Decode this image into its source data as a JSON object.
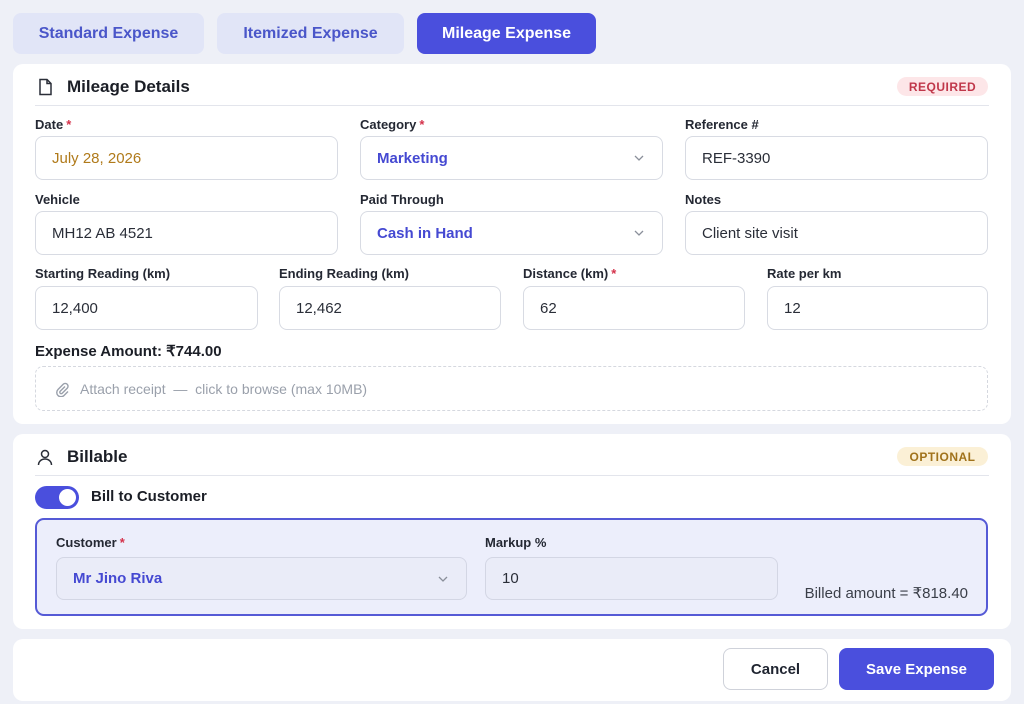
{
  "tabs": [
    {
      "label": "Standard Expense",
      "active": false
    },
    {
      "label": "Itemized Expense",
      "active": false
    },
    {
      "label": "Mileage Expense",
      "active": true
    }
  ],
  "mileage": {
    "title": "Mileage Details",
    "badge": "REQUIRED",
    "date": {
      "label": "Date",
      "value": "July 28, 2026",
      "required": true
    },
    "category": {
      "label": "Category",
      "value": "Marketing",
      "required": true
    },
    "reference": {
      "label": "Reference #",
      "value": "REF-3390"
    },
    "vehicle": {
      "label": "Vehicle",
      "value": "MH12 AB 4521"
    },
    "paid_through": {
      "label": "Paid Through",
      "value": "Cash in Hand"
    },
    "notes": {
      "label": "Notes",
      "value": "Client site visit"
    },
    "start_reading": {
      "label": "Starting Reading (km)",
      "value": "12,400"
    },
    "end_reading": {
      "label": "Ending Reading (km)",
      "value": "12,462"
    },
    "distance": {
      "label": "Distance (km)",
      "value": "62",
      "required": true
    },
    "rate": {
      "label": "Rate per km",
      "value": "12"
    },
    "expense_amount": "Expense Amount: ₹744.00",
    "attach": "Attach receipt  —  click to browse (max 10MB)"
  },
  "billable": {
    "title": "Billable",
    "badge": "OPTIONAL",
    "toggle_label": "Bill to Customer",
    "toggle_on": true,
    "customer": {
      "label": "Customer",
      "value": "Mr Jino Riva",
      "required": true
    },
    "markup": {
      "label": "Markup %",
      "value": "10"
    },
    "billed_amount": "Billed amount = ₹818.40"
  },
  "actions": {
    "cancel": "Cancel",
    "save": "Save Expense"
  },
  "colors": {
    "accent": "#4a4fdd",
    "required_badge": "#c0374a",
    "optional_badge": "#a0721b",
    "date_text": "#b07a1a"
  },
  "icons": {
    "mileage_section": "document-icon",
    "billable_section": "user-icon",
    "attach": "paperclip-icon",
    "select": "chevron-down-icon"
  }
}
